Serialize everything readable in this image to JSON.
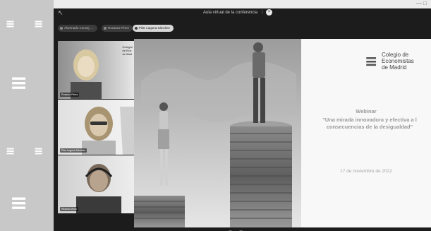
{
  "window": {
    "title": "Aula virtual de la conferencia",
    "separator": "|",
    "close_glyph": "×",
    "back_glyph": "↖"
  },
  "participants": [
    {
      "name": "Alumnado Consej. ...",
      "active": false
    },
    {
      "name": "Rosaura Pérez",
      "active": false
    },
    {
      "name": "Pilar Laguna Sánchez",
      "active": true
    }
  ],
  "videos": [
    {
      "label": "Rosaura Pérez",
      "logo_text": "Colegio\nde Eco\nde Mad"
    },
    {
      "label": "Pilar Laguna Sánchez",
      "logo_text": ""
    },
    {
      "label": "Ricardo Mirón",
      "logo_text": ""
    }
  ],
  "slide": {
    "org_logo_glyph": "≡",
    "org_name": "Colegio de\nEconomistas\nde Madrid",
    "webinar_label": "Webinar",
    "webinar_subtitle": "\"Una mirada innovadora y efectiva a l\nconsecuencias de la desigualdad\"",
    "date": "17 de noviembre de 2022"
  },
  "colors": {
    "app_background": "#1c1c1c",
    "wall_background": "#c8c8c8",
    "slide_text_color": "#9a9a9a"
  },
  "icons": [
    "back-arrow-icon",
    "close-icon",
    "participant-dot-icon",
    "logo-icon"
  ]
}
